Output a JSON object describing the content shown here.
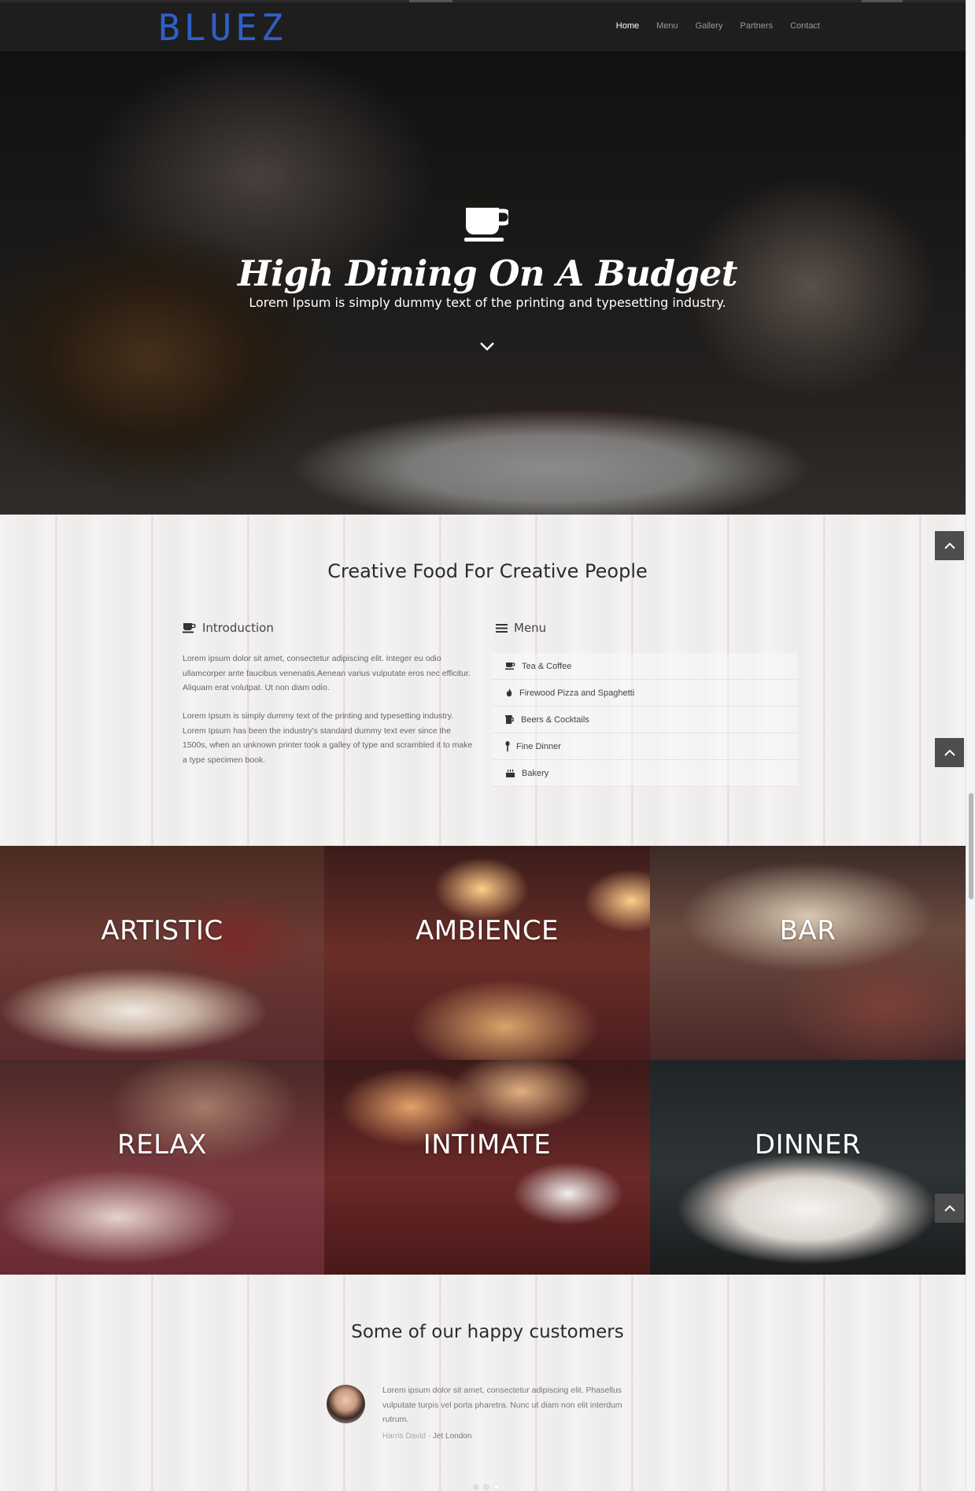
{
  "nav": {
    "logo": "BLUEZ",
    "items": [
      {
        "label": "Home",
        "active": true
      },
      {
        "label": "Menu",
        "active": false
      },
      {
        "label": "Gallery",
        "active": false
      },
      {
        "label": "Partners",
        "active": false
      },
      {
        "label": "Contact",
        "active": false
      }
    ]
  },
  "hero": {
    "icon": "coffee-cup-icon",
    "title": "High Dining On A Budget",
    "subtitle": "Lorem Ipsum is simply dummy text of the printing and typesetting industry.",
    "scroll_icon": "chevron-down-icon"
  },
  "about": {
    "heading": "Creative Food For Creative People",
    "intro": {
      "title": "Introduction",
      "paragraph1": "Lorem ipsum dolor sit amet, consectetur adipiscing elit. Integer eu odio ullamcorper ante faucibus venenatis.Aenean varius vulputate eros nec efficitur. Aliquam erat volutpat. Ut non diam odio.",
      "paragraph2": "Lorem Ipsum is simply dummy text of the printing and typesetting industry. Lorem Ipsum has been the industry's standard dummy text ever since the 1500s, when an unknown printer took a galley of type and scrambled it to make a type specimen book."
    },
    "menu": {
      "title": "Menu",
      "items": [
        {
          "label": "Tea & Coffee",
          "icon": "coffee-cup-icon"
        },
        {
          "label": "Firewood Pizza and Spaghetti",
          "icon": "fire-icon"
        },
        {
          "label": "Beers & Cocktails",
          "icon": "beer-icon"
        },
        {
          "label": "Fine Dinner",
          "icon": "spoon-icon"
        },
        {
          "label": "Bakery",
          "icon": "cake-icon"
        }
      ]
    }
  },
  "gallery": {
    "tiles": [
      "ARTISTIC",
      "AMBIENCE",
      "BAR",
      "RELAX",
      "INTIMATE",
      "DINNER"
    ]
  },
  "testimonials": {
    "heading": "Some of our happy customers",
    "quote": "Lorem ipsum dolor sit amet, consectetur adipiscing elit. Phasellus vulputate turpis vel porta pharetra. Nunc ut diam non elit interdum rutrum.",
    "author_name": "Harris David",
    "author_separator": " - ",
    "author_company": "Jet London"
  },
  "colors": {
    "brand": "#2f5fc9",
    "nav_bg": "#1e1e1e",
    "to_top_button": "#4d4d4d"
  }
}
